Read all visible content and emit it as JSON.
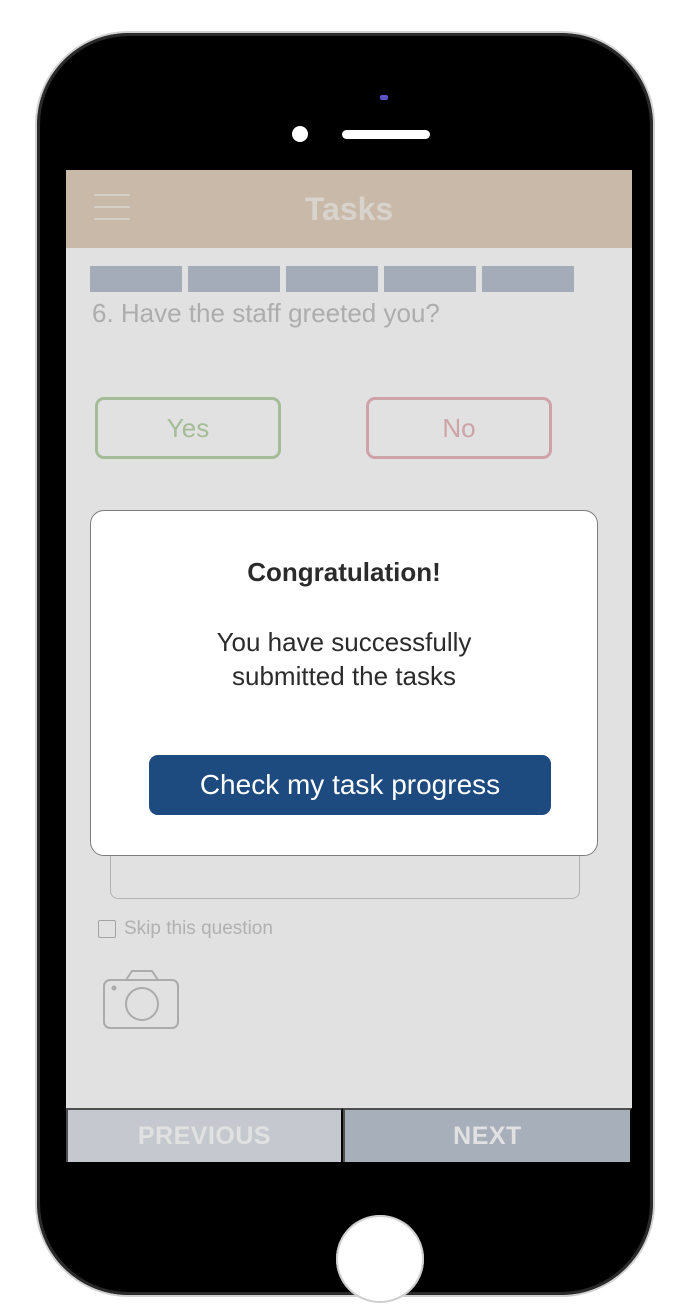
{
  "header": {
    "title": "Tasks",
    "menu_icon": "hamburger-menu-icon",
    "background": "#e2d1bd"
  },
  "progress": {
    "segments": 5,
    "color": "#b8c2d2"
  },
  "question": {
    "text": "6. Have the staff greeted you?"
  },
  "answers": {
    "yes_label": "Yes",
    "no_label": "No",
    "yes_color": "#b8d6a9",
    "no_color": "#e8b7bc"
  },
  "skip": {
    "label": "Skip this question",
    "checked": false
  },
  "camera": {
    "icon": "camera-icon"
  },
  "navigation": {
    "previous_label": "PREVIOUS",
    "next_label": "NEXT"
  },
  "modal": {
    "title": "Congratulation!",
    "message_line1": "You have successfully",
    "message_line2": "submitted the tasks",
    "button_label": "Check my task progress",
    "button_color": "#1d4a7f"
  }
}
